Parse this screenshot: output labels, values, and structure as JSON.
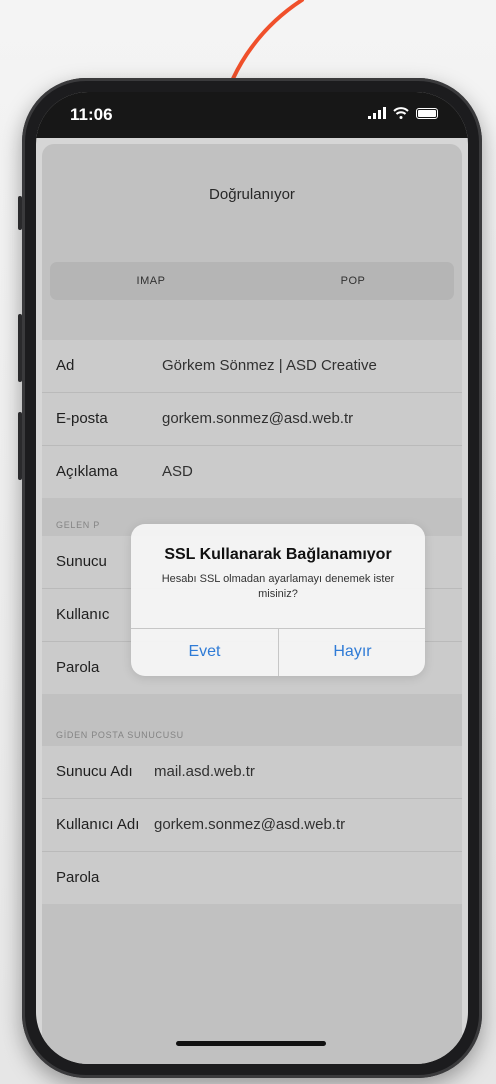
{
  "status_bar": {
    "time": "11:06"
  },
  "nav": {
    "title": "Doğrulanıyor"
  },
  "segment": {
    "imap": "IMAP",
    "pop": "POP"
  },
  "account": {
    "rows": [
      {
        "label": "Ad",
        "value": "Görkem Sönmez | ASD Creative"
      },
      {
        "label": "E-posta",
        "value": "gorkem.sonmez@asd.web.tr"
      },
      {
        "label": "Açıklama",
        "value": "ASD"
      }
    ]
  },
  "incoming": {
    "header": "GELEN P",
    "rows": [
      {
        "label": "Sunucu"
      },
      {
        "label": "Kullanıc"
      },
      {
        "label": "Parola"
      }
    ]
  },
  "outgoing": {
    "header": "GİDEN POSTA SUNUCUSU",
    "rows": [
      {
        "label": "Sunucu Adı",
        "value": "mail.asd.web.tr"
      },
      {
        "label": "Kullanıcı Adı",
        "value": "gorkem.sonmez@asd.web.tr"
      },
      {
        "label": "Parola",
        "value": ""
      }
    ]
  },
  "alert": {
    "title": "SSL Kullanarak Bağlanamıyor",
    "message": "Hesabı SSL olmadan ayarlamayı denemek ister misiniz?",
    "yes": "Evet",
    "no": "Hayır"
  },
  "colors": {
    "accent": "#2f7bd6",
    "annotation_arrow": "#f0502b"
  }
}
